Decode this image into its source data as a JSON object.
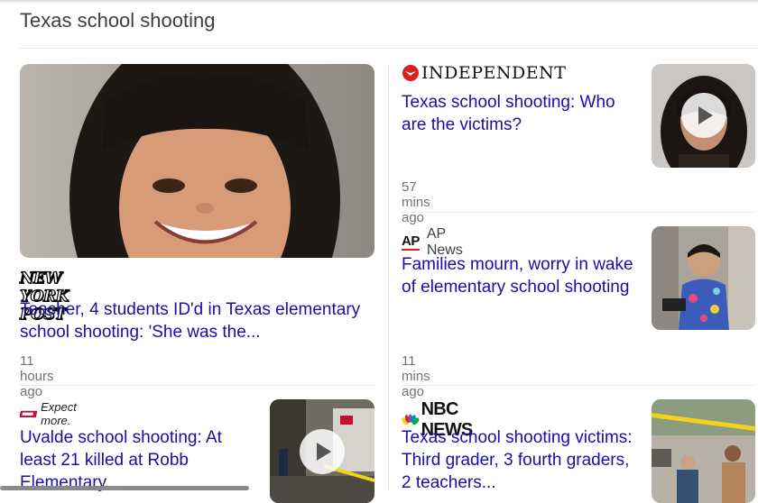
{
  "section": {
    "title": "Texas school shooting"
  },
  "articles": [
    {
      "source": "NEW YORK POST",
      "headline": "Teacher, 4 students ID'd in Texas elementary school shooting: 'She was the...",
      "time": "11 hours ago",
      "has_video": false,
      "thumb": "portrait of woman with bangs smiling"
    },
    {
      "source": "INDEPENDENT",
      "headline": "Texas school shooting: Who are the victims?",
      "time": "57 mins ago",
      "has_video": true,
      "thumb": "portrait of woman with dark hair"
    },
    {
      "source_logo": "AP",
      "source": "AP News",
      "headline": "Families mourn, worry in wake of elementary school shooting",
      "time": "11 mins ago",
      "has_video": false,
      "thumb": "young boy in floral shirt"
    },
    {
      "source": "Expect more.",
      "headline": "Uvalde school shooting: At least 21 killed at Robb Elementary...",
      "time": "",
      "has_video": true,
      "thumb": "police scene with tape"
    },
    {
      "source": "NBC NEWS",
      "headline": "Texas school shooting victims: Third grader, 3 fourth graders, 2 teachers...",
      "time": "",
      "has_video": false,
      "thumb": "people sitting by crime scene tape"
    }
  ],
  "colors": {
    "link": "#1a0dab",
    "meta": "#70757a",
    "divider": "#e8eaed"
  }
}
